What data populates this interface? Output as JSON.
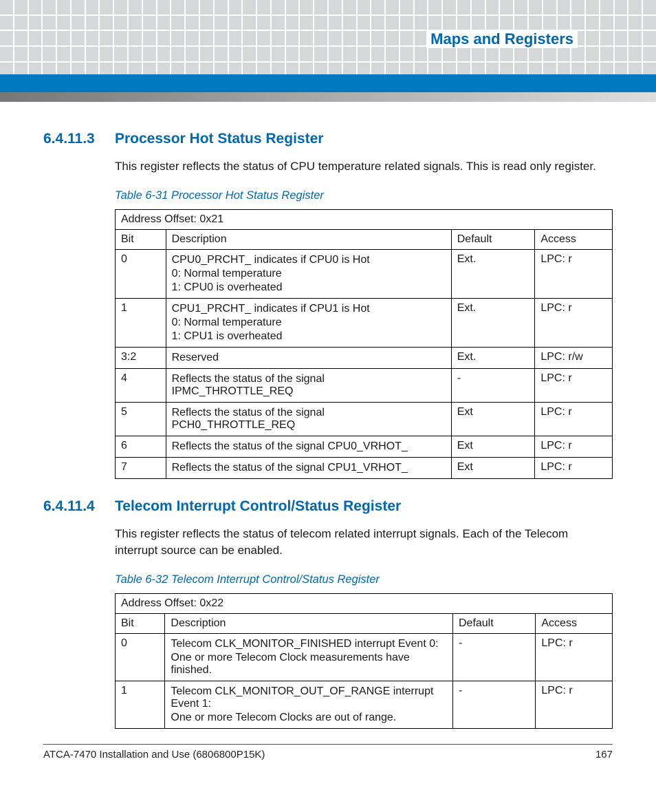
{
  "header": {
    "title": "Maps and Registers"
  },
  "sections": [
    {
      "num": "6.4.11.3",
      "title": "Processor Hot Status Register",
      "body": "This register reflects the status of CPU temperature related signals. This is read only register.",
      "table_caption": "Table 6-31 Processor Hot Status Register",
      "address_offset": "Address Offset: 0x21",
      "cols": {
        "bit": "Bit",
        "desc": "Description",
        "def": "Default",
        "acc": "Access"
      },
      "rows": [
        {
          "bit": "0",
          "desc": [
            "CPU0_PRCHT_ indicates if CPU0 is Hot",
            "0: Normal temperature",
            "1: CPU0 is overheated"
          ],
          "def": "Ext.",
          "acc": "LPC: r"
        },
        {
          "bit": "1",
          "desc": [
            "CPU1_PRCHT_ indicates if CPU1 is Hot",
            "0: Normal temperature",
            "1: CPU1 is overheated"
          ],
          "def": "Ext.",
          "acc": "LPC: r"
        },
        {
          "bit": "3:2",
          "desc": [
            "Reserved"
          ],
          "def": "Ext.",
          "acc": "LPC: r/w"
        },
        {
          "bit": "4",
          "desc": [
            "Reflects the status of the signal IPMC_THROTTLE_REQ"
          ],
          "def": "-",
          "acc": "LPC: r"
        },
        {
          "bit": "5",
          "desc": [
            "Reflects the status of the signal PCH0_THROTTLE_REQ"
          ],
          "def": "Ext",
          "acc": "LPC: r"
        },
        {
          "bit": "6",
          "desc": [
            "Reflects the status of the signal CPU0_VRHOT_"
          ],
          "def": "Ext",
          "acc": "LPC: r"
        },
        {
          "bit": "7",
          "desc": [
            "Reflects the status of the signal CPU1_VRHOT_"
          ],
          "def": "Ext",
          "acc": "LPC: r"
        }
      ]
    },
    {
      "num": "6.4.11.4",
      "title": "Telecom Interrupt Control/Status Register",
      "body": "This register reflects the status of telecom related interrupt signals. Each of the Telecom interrupt source can be enabled.",
      "table_caption": "Table 6-32 Telecom Interrupt Control/Status Register",
      "address_offset": "Address Offset: 0x22",
      "cols": {
        "bit": "Bit",
        "desc": "Description",
        "def": "Default",
        "acc": "Access"
      },
      "rows": [
        {
          "bit": "0",
          "desc": [
            "Telecom CLK_MONITOR_FINISHED interrupt Event 0:",
            "One or more Telecom Clock measurements have finished."
          ],
          "def": "-",
          "acc": "LPC: r"
        },
        {
          "bit": "1",
          "desc": [
            "Telecom CLK_MONITOR_OUT_OF_RANGE interrupt Event 1:",
            "One or more Telecom Clocks are out of range."
          ],
          "def": "-",
          "acc": "LPC: r"
        }
      ]
    }
  ],
  "footer": {
    "left": "ATCA-7470 Installation and Use (6806800P15K)",
    "right": "167"
  }
}
